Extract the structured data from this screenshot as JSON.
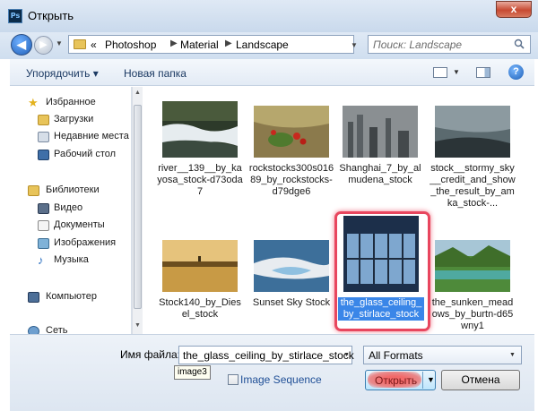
{
  "window": {
    "title": "Открыть",
    "app_icon_text": "Ps",
    "close_label": "x"
  },
  "nav": {
    "crumbs": [
      "«",
      "Photoshop",
      "Material",
      "Landscape"
    ],
    "search_placeholder": "Поиск: Landscape"
  },
  "toolbar": {
    "organize_label": "Упорядочить ▾",
    "new_folder_label": "Новая папка",
    "help_label": "?"
  },
  "sidebar": {
    "favorites_label": "Избранное",
    "favorites": [
      "Загрузки",
      "Недавние места",
      "Рабочий стол"
    ],
    "libraries_label": "Библиотеки",
    "libraries": [
      "Видео",
      "Документы",
      "Изображения",
      "Музыка"
    ],
    "computer_label": "Компьютер",
    "network_label": "Сеть"
  },
  "files": [
    {
      "caption": "river__139__by_kayosa_stock-d73oda7",
      "icon": "image-thumbnail-river"
    },
    {
      "caption": "rockstocks300s01689_by_rockstocks-d79dge6",
      "icon": "image-thumbnail-berries"
    },
    {
      "caption": "Shanghai_7_by_almudena_stock",
      "icon": "image-thumbnail-shanghai"
    },
    {
      "caption": "stock__stormy_sky__credit_and_show_the_result_by_amka_stock-...",
      "icon": "image-thumbnail-stormy-sky"
    },
    {
      "caption": "Stock140_by_Diesel_stock",
      "icon": "image-thumbnail-field"
    },
    {
      "caption": "Sunset Sky Stock",
      "icon": "image-thumbnail-sunset-sky"
    },
    {
      "caption": "the_glass_ceiling_by_stirlace_stock",
      "icon": "image-thumbnail-glass-ceiling",
      "selected": true
    },
    {
      "caption": "the_sunken_meadows_by_burtn-d65wny1",
      "icon": "image-thumbnail-meadows"
    }
  ],
  "bottom": {
    "filename_label": "Имя файла:",
    "filename_value": "the_glass_ceiling_by_stirlace_stock",
    "tooltip": "image3",
    "format_value": "All Formats",
    "image_sequence_label": "Image Sequence",
    "open_label": "Открыть",
    "cancel_label": "Отмена"
  },
  "colors": {
    "accent": "#3a86e8",
    "highlight": "#e8465e",
    "titlebar": "#c9d9ec"
  }
}
